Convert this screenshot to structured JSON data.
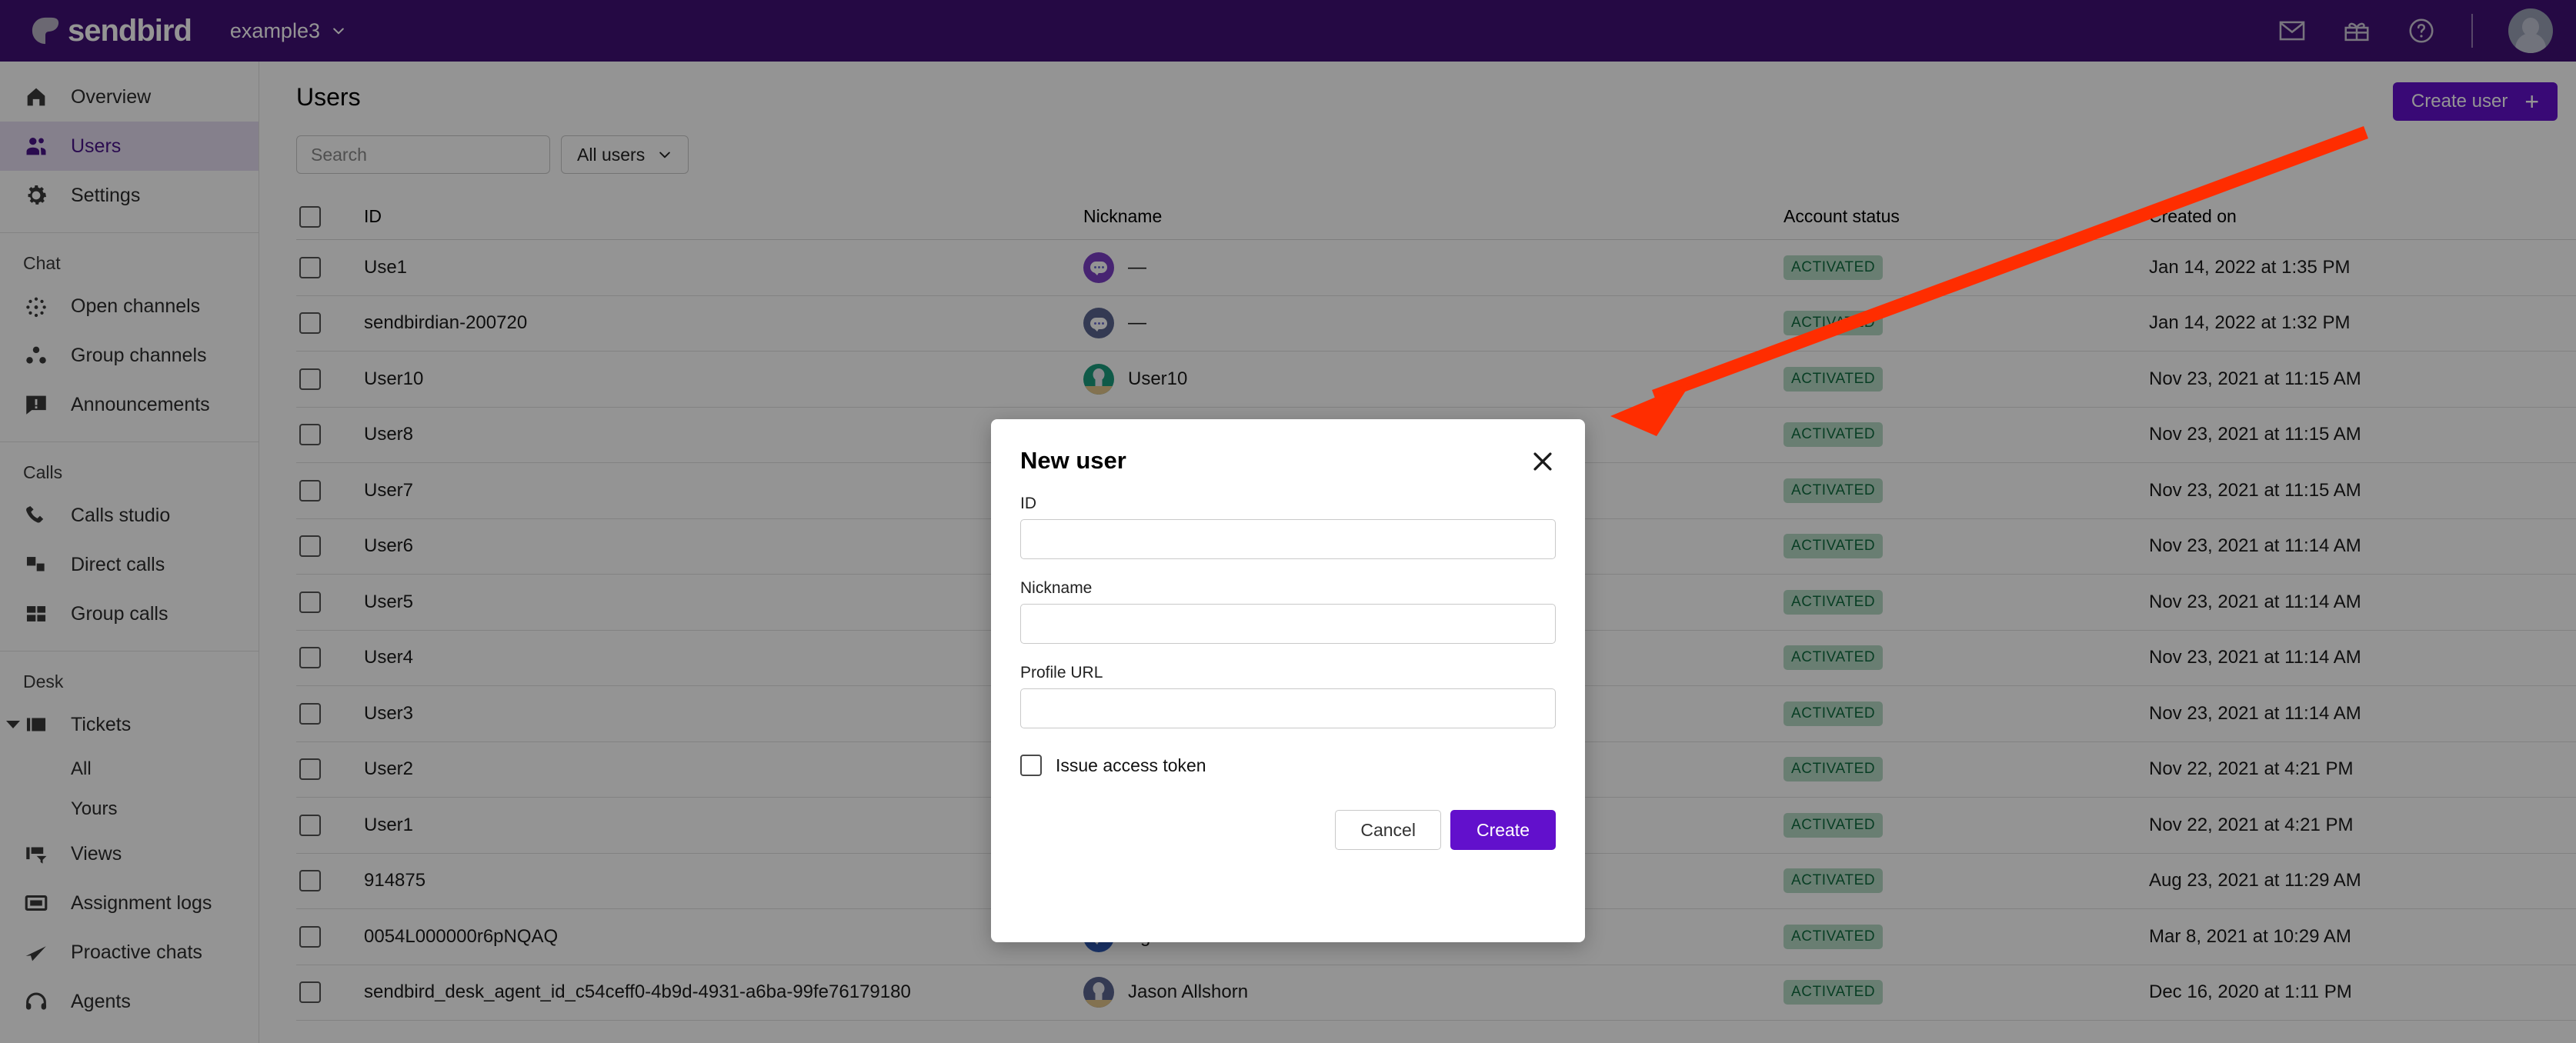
{
  "topbar": {
    "brand": "sendbird",
    "app_name": "example3",
    "icons": [
      "mail-icon",
      "gift-icon",
      "help-icon"
    ]
  },
  "sidebar": {
    "items": [
      {
        "label": "Overview",
        "icon": "home-icon",
        "active": false
      },
      {
        "label": "Users",
        "icon": "users-icon",
        "active": true
      },
      {
        "label": "Settings",
        "icon": "gear-icon",
        "active": false
      }
    ],
    "groups": [
      {
        "title": "Chat",
        "items": [
          {
            "label": "Open channels",
            "icon": "open-channels-icon"
          },
          {
            "label": "Group channels",
            "icon": "group-channels-icon"
          },
          {
            "label": "Announcements",
            "icon": "announcements-icon"
          }
        ]
      },
      {
        "title": "Calls",
        "items": [
          {
            "label": "Calls studio",
            "icon": "phone-icon"
          },
          {
            "label": "Direct calls",
            "icon": "direct-calls-icon"
          },
          {
            "label": "Group calls",
            "icon": "group-calls-icon"
          }
        ]
      },
      {
        "title": "Desk",
        "items": [
          {
            "label": "Tickets",
            "icon": "ticket-icon"
          },
          {
            "label": "All",
            "icon": "",
            "sub": true
          },
          {
            "label": "Yours",
            "icon": "",
            "sub": true
          },
          {
            "label": "Views",
            "icon": "views-icon"
          },
          {
            "label": "Assignment logs",
            "icon": "inbox-icon"
          },
          {
            "label": "Proactive chats",
            "icon": "send-icon"
          },
          {
            "label": "Agents",
            "icon": "headset-icon"
          }
        ]
      }
    ]
  },
  "page": {
    "title": "Users",
    "create_button": "Create user"
  },
  "search": {
    "placeholder": "Search",
    "value": "",
    "icon": "search-icon"
  },
  "filter": {
    "label": "All users",
    "icon": "chevron-down-icon"
  },
  "table": {
    "columns": [
      "ID",
      "Nickname",
      "Account status",
      "Created on"
    ],
    "rows": [
      {
        "id": "Use1",
        "nickname": "—",
        "avatar": "bubble-purple",
        "status": "ACTIVATED",
        "created": "Jan 14, 2022 at 1:35 PM"
      },
      {
        "id": "sendbirdian-200720",
        "nickname": "—",
        "avatar": "bubble-slate",
        "status": "ACTIVATED",
        "created": "Jan 14, 2022 at 1:32 PM"
      },
      {
        "id": "User10",
        "nickname": "User10",
        "avatar": "person-green",
        "status": "ACTIVATED",
        "created": "Nov 23, 2021 at 11:15 AM"
      },
      {
        "id": "User8",
        "nickname": "",
        "avatar": "",
        "status": "ACTIVATED",
        "created": "Nov 23, 2021 at 11:15 AM"
      },
      {
        "id": "User7",
        "nickname": "",
        "avatar": "",
        "status": "ACTIVATED",
        "created": "Nov 23, 2021 at 11:15 AM"
      },
      {
        "id": "User6",
        "nickname": "",
        "avatar": "",
        "status": "ACTIVATED",
        "created": "Nov 23, 2021 at 11:14 AM"
      },
      {
        "id": "User5",
        "nickname": "",
        "avatar": "",
        "status": "ACTIVATED",
        "created": "Nov 23, 2021 at 11:14 AM"
      },
      {
        "id": "User4",
        "nickname": "",
        "avatar": "",
        "status": "ACTIVATED",
        "created": "Nov 23, 2021 at 11:14 AM"
      },
      {
        "id": "User3",
        "nickname": "",
        "avatar": "",
        "status": "ACTIVATED",
        "created": "Nov 23, 2021 at 11:14 AM"
      },
      {
        "id": "User2",
        "nickname": "",
        "avatar": "",
        "status": "ACTIVATED",
        "created": "Nov 22, 2021 at 4:21 PM"
      },
      {
        "id": "User1",
        "nickname": "",
        "avatar": "",
        "status": "ACTIVATED",
        "created": "Nov 22, 2021 at 4:21 PM"
      },
      {
        "id": "914875",
        "nickname": "",
        "avatar": "",
        "status": "ACTIVATED",
        "created": "Aug 23, 2021 at 11:29 AM"
      },
      {
        "id": "0054L000000r6pNQAQ",
        "nickname": "Agent1",
        "avatar": "bubble-blue",
        "status": "ACTIVATED",
        "created": "Mar 8, 2021 at 10:29 AM"
      },
      {
        "id": "sendbird_desk_agent_id_c54ceff0-4b9d-4931-a6ba-99fe76179180",
        "nickname": "Jason Allshorn",
        "avatar": "person-slate",
        "status": "ACTIVATED",
        "created": "Dec 16, 2020 at 1:11 PM"
      }
    ]
  },
  "modal": {
    "title": "New user",
    "close_icon": "close-icon",
    "fields": [
      {
        "label": "ID",
        "value": "",
        "placeholder": ""
      },
      {
        "label": "Nickname",
        "value": "",
        "placeholder": ""
      },
      {
        "label": "Profile URL",
        "value": "",
        "placeholder": ""
      }
    ],
    "checkbox_label": "Issue access token",
    "checkbox_checked": false,
    "cancel_label": "Cancel",
    "create_label": "Create"
  },
  "colors": {
    "topbar_purple": "#411076",
    "accent_purple": "#6210CC",
    "active_nav_bg": "#E6DCF2",
    "active_nav_text": "#491389",
    "badge_bg": "#B5D9C4",
    "badge_text": "#0F6B3F",
    "annotation_red": "#FF2D00"
  }
}
